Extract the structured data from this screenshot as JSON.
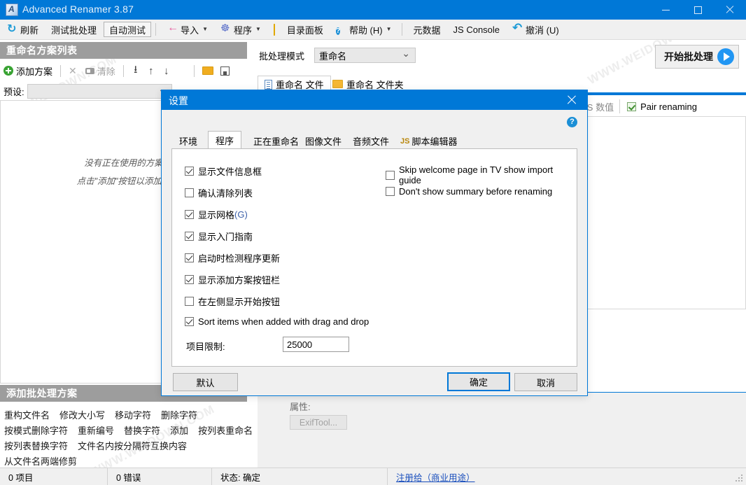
{
  "window": {
    "title": "Advanced Renamer 3.87",
    "icon": "app-icon",
    "minimize": "minimize",
    "maximize": "maximize",
    "close": "close"
  },
  "toolbar": {
    "items": [
      {
        "label": "刷新",
        "icon": "refresh-icon",
        "caret": false,
        "pressed": false
      },
      {
        "label": "测试批处理",
        "icon": "",
        "caret": false,
        "pressed": false
      },
      {
        "label": "自动测试",
        "icon": "",
        "caret": false,
        "pressed": true
      },
      {
        "label": "导入",
        "icon": "import-icon",
        "caret": true,
        "pressed": false
      },
      {
        "label": "程序",
        "icon": "program-icon",
        "caret": true,
        "pressed": false
      },
      {
        "label": "目录面板",
        "icon": "folder-icon",
        "caret": false,
        "pressed": false
      },
      {
        "label": "帮助 (H)",
        "icon": "help-icon",
        "caret": true,
        "pressed": false
      },
      {
        "label": "元数据",
        "icon": "",
        "caret": false,
        "pressed": false
      },
      {
        "label": "JS Console",
        "icon": "",
        "caret": false,
        "pressed": false
      },
      {
        "label": "撤消 (U)",
        "icon": "undo-icon",
        "caret": false,
        "pressed": false
      }
    ]
  },
  "scheme_panel": {
    "header": "重命名方案列表",
    "toolbar": {
      "add": "添加方案",
      "remove": "",
      "clear": "清除",
      "move_top": "move-to-top",
      "move_up": "move-up",
      "move_down": "move-down",
      "move_bottom": "move-to-bottom",
      "open": "open-folder",
      "save": "save"
    },
    "preset_label": "预设:",
    "preset_value": "",
    "empty_line1": "没有正在使用的方案",
    "empty_line2": "点击\"添加\"按钮以添加新"
  },
  "add_batch_panel": {
    "header": "添加批处理方案",
    "rows": [
      [
        "重构文件名",
        "修改大小写",
        "移动字符",
        "删除字符"
      ],
      [
        "按模式删除字符",
        "重新编号",
        "替换字符",
        "添加",
        "按列表重命名"
      ],
      [
        "按列表替换字符",
        "文件名内按分隔符互换内容"
      ],
      [
        "从文件名两端修剪"
      ]
    ]
  },
  "main": {
    "mode_label": "批处理模式",
    "mode_value": "重命名",
    "start_button": "开始批处理",
    "tabs": [
      {
        "label": "重命名 文件",
        "icon": "document-icon",
        "active": true
      },
      {
        "label": "重命名 文件夹",
        "icon": "folder-icon",
        "active": false
      }
    ],
    "gps_label": "GPS 数值",
    "pair_renaming": "Pair renaming",
    "properties_label": "属性:",
    "exiftool_button": "ExifTool..."
  },
  "dialog": {
    "title": "设置",
    "help": "?",
    "close": "close",
    "tabs": [
      {
        "label": "环境",
        "active": false,
        "js": false
      },
      {
        "label": "程序",
        "active": true,
        "js": false
      },
      {
        "label": "正在重命名",
        "active": false,
        "js": false
      },
      {
        "label": "图像文件",
        "active": false,
        "js": false
      },
      {
        "label": "音频文件",
        "active": false,
        "js": false
      },
      {
        "label": "脚本编辑器",
        "active": false,
        "js": true,
        "js_mark": "JS"
      }
    ],
    "left_options": [
      {
        "label": "显示文件信息框",
        "checked": true,
        "accel": ""
      },
      {
        "label": "确认清除列表",
        "checked": false,
        "accel": ""
      },
      {
        "label": "显示网格 ",
        "checked": true,
        "accel": "(G)"
      },
      {
        "label": "显示入门指南",
        "checked": true,
        "accel": ""
      },
      {
        "label": "启动时检测程序更新",
        "checked": true,
        "accel": ""
      },
      {
        "label": "显示添加方案按钮栏",
        "checked": true,
        "accel": ""
      },
      {
        "label": "在左侧显示开始按钮",
        "checked": false,
        "accel": ""
      },
      {
        "label": "Sort items when added with drag and drop",
        "checked": true,
        "accel": ""
      }
    ],
    "right_options": [
      {
        "label": "Skip welcome page in TV show import guide",
        "checked": false
      },
      {
        "label": "Don't show summary before renaming",
        "checked": false
      }
    ],
    "limit_label": "项目限制:",
    "limit_value": "25000",
    "buttons": {
      "default": "默认",
      "ok": "确定",
      "cancel": "取消"
    }
  },
  "statusbar": {
    "items": "0 项目",
    "errors": "0 错误",
    "status": "状态: 确定",
    "register_link": "注册给（商业用途）"
  },
  "watermarks": [
    "WWW.WEIDOWN.COM",
    "WWW.WEIDOWN.COM",
    "WWW.WEIDOWN.COM",
    "WWW.WEIDOWN.COM",
    "WWW.WEIDOWN.COM",
    "WWW.WEIDOWN.COM",
    "WWW.WEIDOWN.COM",
    "WWW.WEIDOWN.COM",
    "WWW.WEIDOWN.COM"
  ]
}
